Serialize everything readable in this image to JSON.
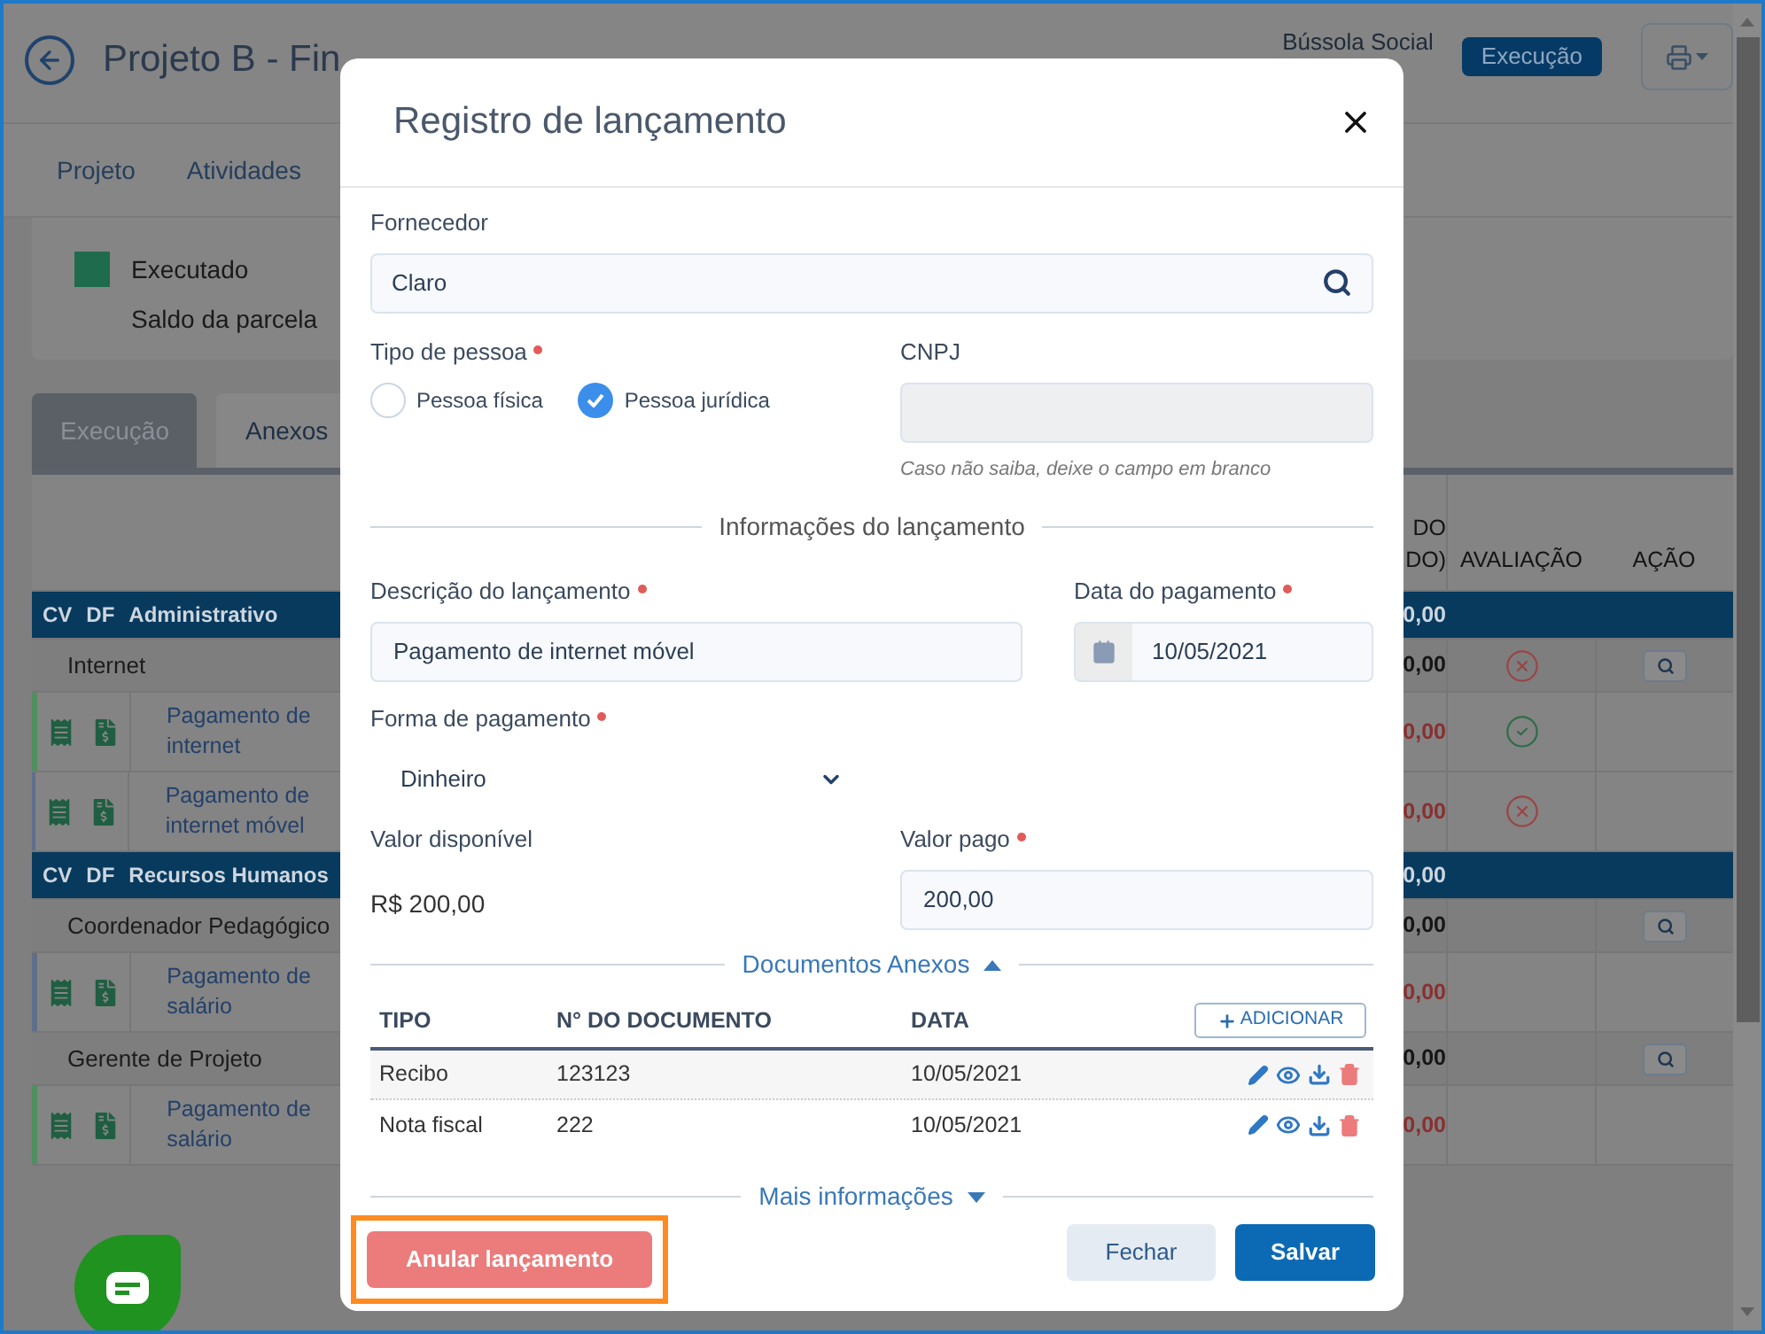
{
  "page": {
    "title": "Projeto B - Fin",
    "organization": "Bússola Social",
    "status_badge": "Execução"
  },
  "nav_tabs": [
    {
      "label": "Projeto"
    },
    {
      "label": "Atividades"
    }
  ],
  "legend": [
    {
      "label": "Executado",
      "color": "#1f6b4d"
    },
    {
      "label": "Saldo da parcela"
    }
  ],
  "content_tabs": [
    {
      "label": "Execução",
      "selected": true
    },
    {
      "label": "Anexos",
      "selected": false
    }
  ],
  "table": {
    "columns": [
      {
        "lines": [
          "DO",
          "DO)"
        ]
      },
      {
        "lines": [
          "AVALIAÇÃO"
        ]
      },
      {
        "lines": [
          "AÇÃO"
        ]
      }
    ],
    "rows": [
      {
        "kind": "group",
        "codes": [
          "CV",
          "DF"
        ],
        "label": "Administrativo",
        "value": "0,00"
      },
      {
        "kind": "item",
        "label": "Internet",
        "value": "0,00",
        "approved": false,
        "search": true
      },
      {
        "kind": "entry",
        "label": "Pagamento de internet",
        "value": "0,00",
        "approved": true,
        "color": "#4f8f5f"
      },
      {
        "kind": "entry",
        "label": "Pagamento de internet móvel",
        "value": "0,00",
        "approved": false,
        "color": "#5e6f8c"
      },
      {
        "kind": "group",
        "codes": [
          "CV",
          "DF"
        ],
        "label": "Recursos Humanos",
        "value": "0,00"
      },
      {
        "kind": "item",
        "label": "Coordenador Pedagógico",
        "value": "0,00",
        "search": true
      },
      {
        "kind": "entry",
        "label": "Pagamento de salário",
        "value": "0,00",
        "color": "#5e6f8c"
      },
      {
        "kind": "item",
        "label": "Gerente de Projeto",
        "value": "0,00",
        "search": true
      },
      {
        "kind": "entry",
        "label": "Pagamento de salário",
        "value": "0,00",
        "color": "#4f8f5f"
      }
    ]
  },
  "modal": {
    "title": "Registro de lançamento",
    "supplier": {
      "label": "Fornecedor",
      "value": "Claro"
    },
    "person_type": {
      "label": "Tipo de pessoa",
      "required": true,
      "options": [
        {
          "label": "Pessoa física",
          "selected": false
        },
        {
          "label": "Pessoa jurídica",
          "selected": true
        }
      ]
    },
    "cnpj": {
      "label": "CNPJ",
      "disabled": true,
      "hint": "Caso não saiba, deixe o campo em branco"
    },
    "section_info": "Informações do lançamento",
    "description": {
      "label": "Descrição do lançamento",
      "required": true,
      "value": "Pagamento de internet móvel"
    },
    "payment_date": {
      "label": "Data do pagamento",
      "required": true,
      "value": "10/05/2021"
    },
    "payment_method": {
      "label": "Forma de pagamento",
      "required": true,
      "value": "Dinheiro"
    },
    "available": {
      "label": "Valor disponível",
      "value": "R$ 200,00"
    },
    "paid": {
      "label": "Valor pago",
      "required": true,
      "value": "200,00"
    },
    "documents": {
      "title": "Documentos Anexos",
      "expanded": true,
      "add_label": "ADICIONAR",
      "columns": [
        "TIPO",
        "N° DO DOCUMENTO",
        "DATA"
      ],
      "rows": [
        {
          "type": "Recibo",
          "number": "123123",
          "date": "10/05/2021"
        },
        {
          "type": "Nota fiscal",
          "number": "222",
          "date": "10/05/2021"
        }
      ]
    },
    "more_info": {
      "title": "Mais informações",
      "expanded": false
    },
    "buttons": {
      "void": {
        "label": "Anular lançamento",
        "highlighted": true
      },
      "close": "Fechar",
      "save": "Salvar"
    }
  }
}
